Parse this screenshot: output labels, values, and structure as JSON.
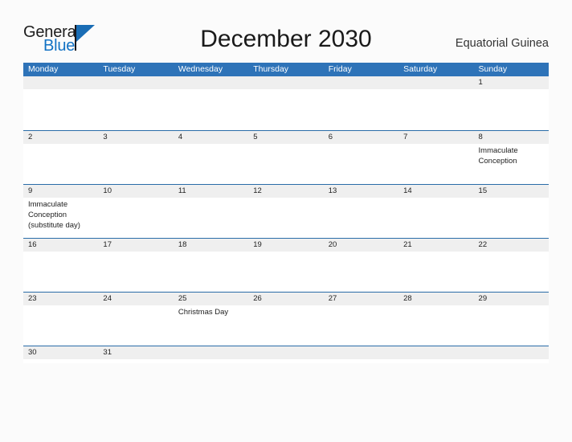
{
  "brand": {
    "name_part1": "General",
    "name_part2": "Blue",
    "flag_icon": "blue-flag-triangle",
    "colors": {
      "dark_text": "#1d1d1d",
      "blue": "#1272c4",
      "flag_blue": "#1a6db5"
    }
  },
  "header": {
    "title": "December 2030",
    "region": "Equatorial Guinea"
  },
  "calendar": {
    "month": "December",
    "year": "2030",
    "accent_color": "#2e73b8",
    "row_divider_color": "#2a6ca8",
    "date_band_color": "#efefef",
    "day_headers": [
      "Monday",
      "Tuesday",
      "Wednesday",
      "Thursday",
      "Friday",
      "Saturday",
      "Sunday"
    ],
    "weeks": [
      {
        "size": "tall",
        "days": [
          {
            "num": "",
            "events": []
          },
          {
            "num": "",
            "events": []
          },
          {
            "num": "",
            "events": []
          },
          {
            "num": "",
            "events": []
          },
          {
            "num": "",
            "events": []
          },
          {
            "num": "",
            "events": []
          },
          {
            "num": "1",
            "events": []
          }
        ]
      },
      {
        "size": "tall",
        "days": [
          {
            "num": "2",
            "events": []
          },
          {
            "num": "3",
            "events": []
          },
          {
            "num": "4",
            "events": []
          },
          {
            "num": "5",
            "events": []
          },
          {
            "num": "6",
            "events": []
          },
          {
            "num": "7",
            "events": []
          },
          {
            "num": "8",
            "events": [
              "Immaculate",
              "Conception"
            ]
          }
        ]
      },
      {
        "size": "tall",
        "days": [
          {
            "num": "9",
            "events": [
              "Immaculate",
              "Conception",
              "(substitute day)"
            ]
          },
          {
            "num": "10",
            "events": []
          },
          {
            "num": "11",
            "events": []
          },
          {
            "num": "12",
            "events": []
          },
          {
            "num": "13",
            "events": []
          },
          {
            "num": "14",
            "events": []
          },
          {
            "num": "15",
            "events": []
          }
        ]
      },
      {
        "size": "tall",
        "days": [
          {
            "num": "16",
            "events": []
          },
          {
            "num": "17",
            "events": []
          },
          {
            "num": "18",
            "events": []
          },
          {
            "num": "19",
            "events": []
          },
          {
            "num": "20",
            "events": []
          },
          {
            "num": "21",
            "events": []
          },
          {
            "num": "22",
            "events": []
          }
        ]
      },
      {
        "size": "tall",
        "days": [
          {
            "num": "23",
            "events": []
          },
          {
            "num": "24",
            "events": []
          },
          {
            "num": "25",
            "events": [
              "Christmas Day"
            ]
          },
          {
            "num": "26",
            "events": []
          },
          {
            "num": "27",
            "events": []
          },
          {
            "num": "28",
            "events": []
          },
          {
            "num": "29",
            "events": []
          }
        ]
      },
      {
        "size": "short",
        "days": [
          {
            "num": "30",
            "events": []
          },
          {
            "num": "31",
            "events": []
          },
          {
            "num": "",
            "events": []
          },
          {
            "num": "",
            "events": []
          },
          {
            "num": "",
            "events": []
          },
          {
            "num": "",
            "events": []
          },
          {
            "num": "",
            "events": []
          }
        ]
      }
    ]
  }
}
